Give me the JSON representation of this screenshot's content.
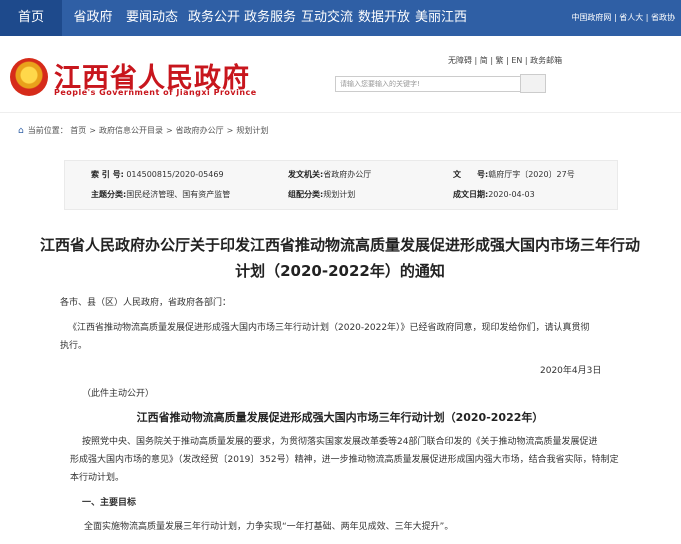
{
  "nav": {
    "items": [
      "首页",
      "省政府",
      "要闻动态",
      "政务公开",
      "政务服务",
      "互动交流",
      "数据开放",
      "美丽江西"
    ],
    "right_links": "中国政府网 | 省人大 | 省政协"
  },
  "header": {
    "title": "江西省人民政府",
    "subtitle": "People's Government of Jiangxi Province",
    "utility_links": "无障碍 | 简 | 繁 | EN | 政务邮箱",
    "search_placeholder": "请输入您要输入的关键字!"
  },
  "breadcrumb": {
    "label": "当前位置：",
    "items": [
      "首页",
      "政府信息公开目录",
      "省政府办公厅",
      "规划计划"
    ]
  },
  "meta": {
    "index_label": "索 引 号:",
    "index_value": "014500815/2020-05469",
    "issuer_label": "发文机关:",
    "issuer_value": "省政府办公厅",
    "doc_label": "文　　号:",
    "doc_value": "赣府厅字〔2020〕27号",
    "topic_label": "主题分类:",
    "topic_value": "国民经济管理、国有资产监管",
    "genre_label": "组配分类:",
    "genre_value": "规划计划",
    "date_label": "成文日期:",
    "date_value": "2020-04-03"
  },
  "article": {
    "title_line1": "江西省人民政府办公厅关于印发江西省推动物流高质量发展促进形成强大国内市场三年行动",
    "title_line2": "计划（2020-2022年）的通知",
    "salutation": "各市、县（区）人民政府，省政府各部门：",
    "para1_line1": "《江西省推动物流高质量发展促进形成强大国内市场三年行动计划（2020-2022年）》已经省政府同意，现印发给你们，请认真贯彻",
    "para1_line2": "执行。",
    "date": "2020年4月3日",
    "disclosure": "（此件主动公开）",
    "plan_title": "江西省推动物流高质量发展促进形成强大国内市场三年行动计划（2020-2022年）",
    "para2_line1": "按照党中央、国务院关于推动高质量发展的要求，为贯彻落实国家发展改革委等24部门联合印发的《关于推动物流高质量发展促进",
    "para2_line2": "形成强大国内市场的意见》（发改经贸〔2019〕352号）精神，进一步推动物流高质量发展促进形成国内强大市场，结合我省实际，特制定",
    "para2_line3": "本行动计划。",
    "section1": "一、主要目标",
    "para3": "全面实施物流高质量发展三年行动计划，力争实现“一年打基础、两年见成效、三年大提升”。"
  }
}
